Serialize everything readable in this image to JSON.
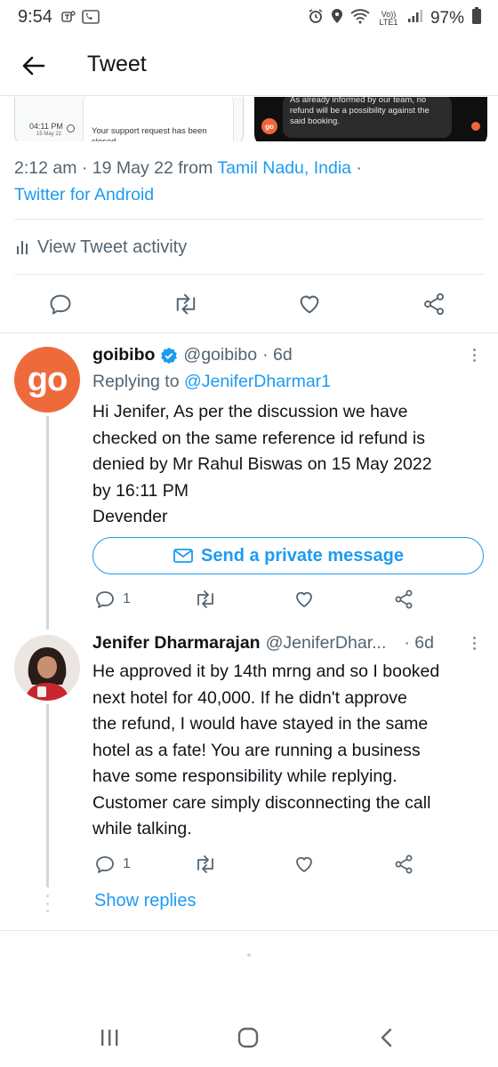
{
  "status_bar": {
    "time": "9:54",
    "battery": "97%",
    "network": "Vo)) LTE1",
    "icons": [
      "teams-icon",
      "phone-app-icon",
      "alarm-icon",
      "location-icon",
      "wifi-icon",
      "signal-icon",
      "battery-icon"
    ]
  },
  "app_bar": {
    "title": "Tweet"
  },
  "media": {
    "left_time": "04:11 PM",
    "left_date": "15 May 22",
    "left_text": "Your support request has been closed",
    "right_text": "As already informed by our team, no refund will be a possibility against the said booking.",
    "right_logo": "go"
  },
  "meta": {
    "datetime": "2:12 am · 19 May 22 from",
    "location": "Tamil Nadu, India",
    "separator": " ·",
    "source": "Twitter for Android"
  },
  "activity": {
    "label": "View Tweet activity"
  },
  "tweets": [
    {
      "avatar_text": "go",
      "name": "goibibo",
      "handle": "@goibibo",
      "time": "· 6d",
      "replying_prefix": "Replying to",
      "replying_to": "@JeniferDharmar1",
      "body": "Hi Jenifer, As per the discussion we have\nchecked on the same reference id refund  is\ndenied by Mr Rahul Biswas on 15 May 2022\nby 16:11 PM\nDevender",
      "dm_label": "Send a private message",
      "reply_count": "1"
    },
    {
      "name": "Jenifer Dharmarajan",
      "handle": "@JeniferDhar...",
      "time": "· 6d",
      "body": "He approved it by 14th mrng and so I booked\nnext hotel for 40,000. If he didn't approve\nthe refund, I would have stayed in the same\nhotel as a fate! You are running a business\nhave some responsibility while replying.\nCustomer care simply disconnecting the call\nwhile talking.",
      "reply_count": "1",
      "show_replies": "Show replies"
    }
  ],
  "colors": {
    "accent": "#1d9bf0",
    "goibibo": "#ef6a3b",
    "muted": "#536471"
  }
}
